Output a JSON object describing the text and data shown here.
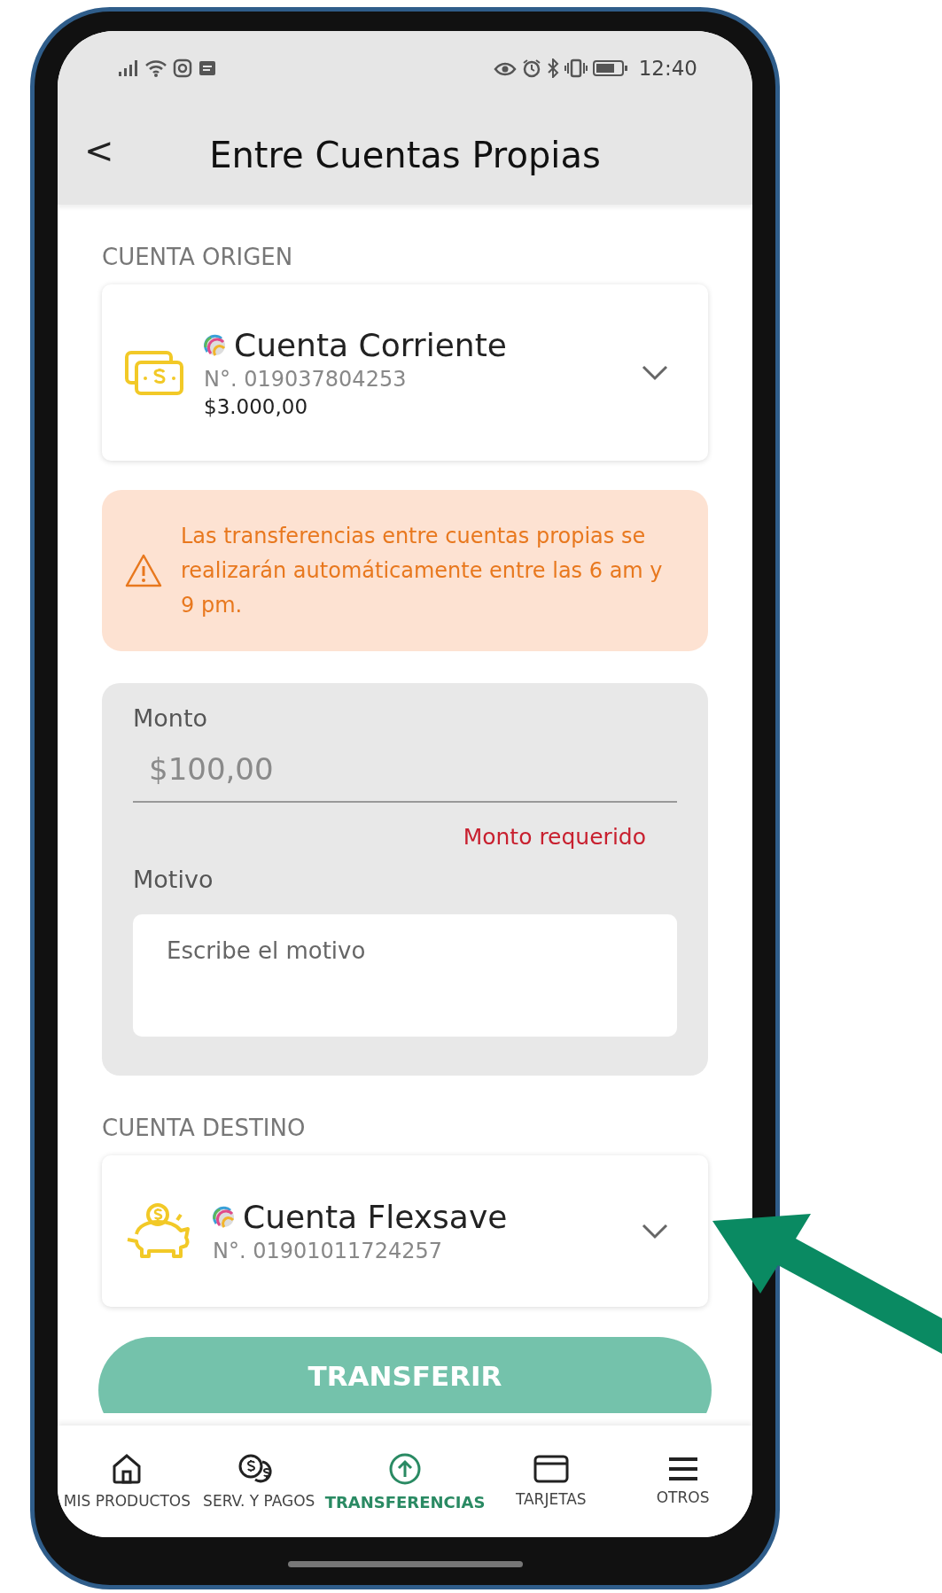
{
  "status_bar": {
    "time": "12:40"
  },
  "header": {
    "back": "<",
    "title": "Entre Cuentas Propias"
  },
  "origin": {
    "label": "CUENTA ORIGEN",
    "account": {
      "name": "Cuenta Corriente",
      "number": "N°. 019037804253",
      "balance": "$3.000,00"
    }
  },
  "notice": {
    "text": "Las transferencias entre cuentas propias se realizarán automáticamente entre las 6 am y 9 pm."
  },
  "form": {
    "amount": {
      "label": "Monto",
      "placeholder": "$100,00",
      "error": "Monto requerido"
    },
    "reason": {
      "label": "Motivo",
      "placeholder": "Escribe el motivo"
    }
  },
  "destination": {
    "label": "CUENTA DESTINO",
    "account": {
      "name": "Cuenta Flexsave",
      "number": "N°. 01901011724257"
    }
  },
  "submit": "TRANSFERIR",
  "nav": {
    "items": [
      {
        "label": "MIS PRODUCTOS",
        "selected": false
      },
      {
        "label": "SERV. Y PAGOS",
        "selected": false
      },
      {
        "label": "TRANSFERENCIAS",
        "selected": true
      },
      {
        "label": "TARJETAS",
        "selected": false
      },
      {
        "label": "OTROS",
        "selected": false
      }
    ]
  }
}
